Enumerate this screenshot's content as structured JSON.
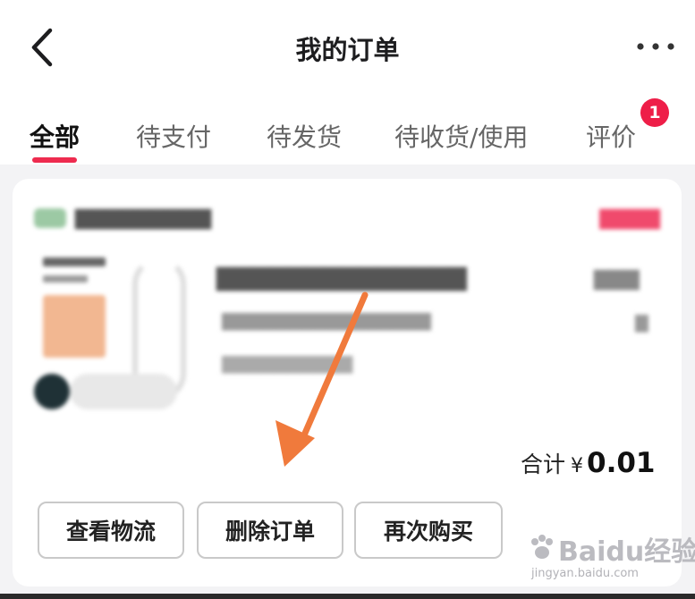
{
  "header": {
    "title": "我的订单",
    "back_icon": "back-arrow-icon",
    "more_icon": "more-dots-icon"
  },
  "tabs": [
    {
      "label": "全部",
      "active": true
    },
    {
      "label": "待支付",
      "active": false
    },
    {
      "label": "待发货",
      "active": false
    },
    {
      "label": "待收货/使用",
      "active": false
    },
    {
      "label": "评价",
      "active": false,
      "badge": "1"
    }
  ],
  "order": {
    "total_label": "合计",
    "currency": "¥",
    "total_amount": "0.01",
    "buttons": {
      "logistics": "查看物流",
      "delete": "删除订单",
      "rebuy": "再次购买"
    }
  },
  "watermark": {
    "brand": "Baidu经验",
    "url": "jingyan.baidu.com"
  },
  "colors": {
    "accent": "#ee2b4f",
    "badge": "#ee1e48",
    "annotation_arrow": "#f07a3c",
    "background": "#f3f3f5"
  }
}
